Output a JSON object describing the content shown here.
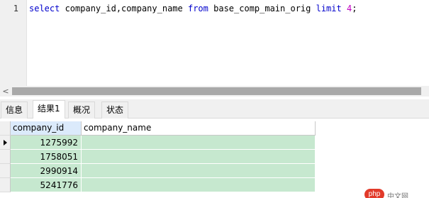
{
  "editor": {
    "line_number": "1",
    "tokens": {
      "select": "select",
      "columns": " company_id,company_name ",
      "from": "from",
      "table": " base_comp_main_orig ",
      "limit": "limit",
      "space": " ",
      "count": "4",
      "end": ";"
    }
  },
  "scrollbar": {
    "left_arrow": "<"
  },
  "tabs": [
    "信息",
    "结果1",
    "概况",
    "状态"
  ],
  "grid": {
    "columns": [
      "company_id",
      "company_name"
    ],
    "rows": [
      {
        "company_id": "1275992",
        "company_name": ""
      },
      {
        "company_id": "1758051",
        "company_name": ""
      },
      {
        "company_id": "2990914",
        "company_name": ""
      },
      {
        "company_id": "5241776",
        "company_name": ""
      }
    ]
  },
  "watermark": {
    "badge": "php",
    "site": "中文网"
  }
}
